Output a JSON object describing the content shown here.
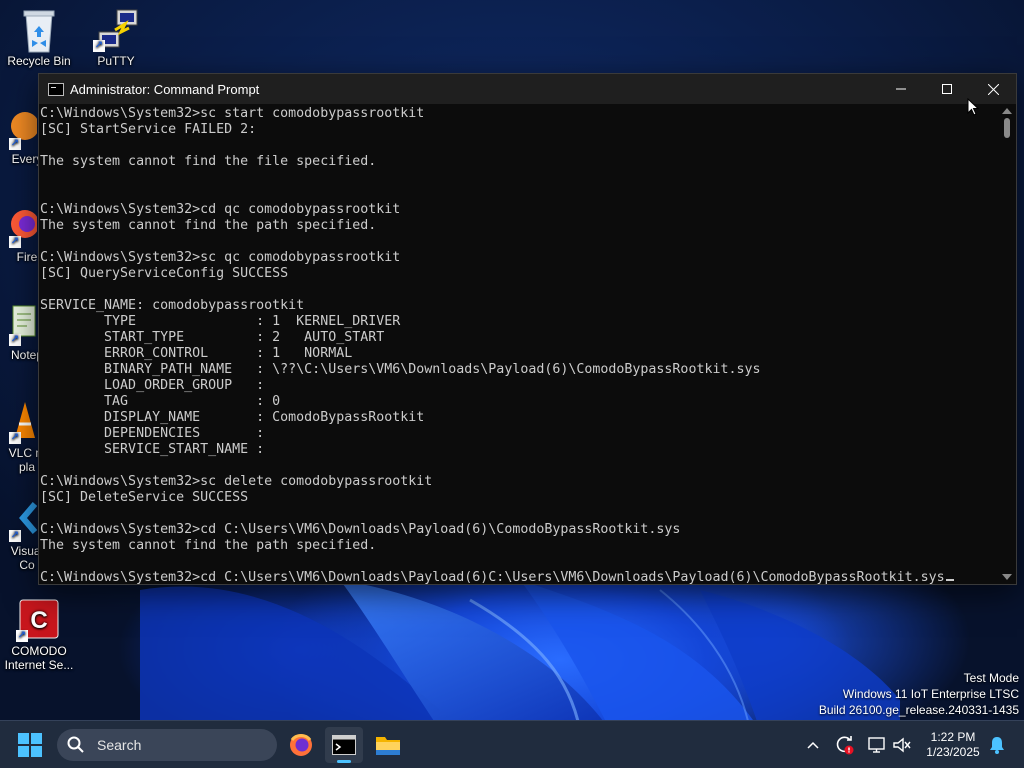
{
  "desktop": {
    "icons": [
      {
        "label": "Recycle Bin"
      },
      {
        "label": "PuTTY"
      },
      {
        "label": "Every"
      },
      {
        "label": "Fire"
      },
      {
        "label": "Notep"
      },
      {
        "label": "VLC m\npla"
      },
      {
        "label": "Visual\nCo"
      },
      {
        "label": "COMODO\nInternet Se..."
      }
    ]
  },
  "window": {
    "title": "Administrator: Command Prompt",
    "minimize": "—",
    "maximize": "☐",
    "close": "✕",
    "lines": [
      "C:\\Windows\\System32>sc start comodobypassrootkit",
      "[SC] StartService FAILED 2:",
      "",
      "The system cannot find the file specified.",
      "",
      "",
      "C:\\Windows\\System32>cd qc comodobypassrootkit",
      "The system cannot find the path specified.",
      "",
      "C:\\Windows\\System32>sc qc comodobypassrootkit",
      "[SC] QueryServiceConfig SUCCESS",
      "",
      "SERVICE_NAME: comodobypassrootkit",
      "        TYPE               : 1  KERNEL_DRIVER",
      "        START_TYPE         : 2   AUTO_START",
      "        ERROR_CONTROL      : 1   NORMAL",
      "        BINARY_PATH_NAME   : \\??\\C:\\Users\\VM6\\Downloads\\Payload(6)\\ComodoBypassRootkit.sys",
      "        LOAD_ORDER_GROUP   :",
      "        TAG                : 0",
      "        DISPLAY_NAME       : ComodoBypassRootkit",
      "        DEPENDENCIES       :",
      "        SERVICE_START_NAME :",
      "",
      "C:\\Windows\\System32>sc delete comodobypassrootkit",
      "[SC] DeleteService SUCCESS",
      "",
      "C:\\Windows\\System32>cd C:\\Users\\VM6\\Downloads\\Payload(6)\\ComodoBypassRootkit.sys",
      "The system cannot find the path specified.",
      ""
    ],
    "current_input": "C:\\Windows\\System32>cd C:\\Users\\VM6\\Downloads\\Payload(6)C:\\Users\\VM6\\Downloads\\Payload(6)\\ComodoBypassRootkit.sys"
  },
  "watermark": {
    "line1": "Test Mode",
    "line2": "Windows 11 IoT Enterprise LTSC",
    "line3": "Build 26100.ge_release.240331-1435"
  },
  "taskbar": {
    "search_label": "Search",
    "time": "1:22 PM",
    "date": "1/23/2025"
  },
  "colors": {
    "console_bg": "#0c0c0c",
    "console_text": "#cccccc",
    "taskbar_bg": "#202c3e",
    "accent": "#4cc2ff"
  }
}
